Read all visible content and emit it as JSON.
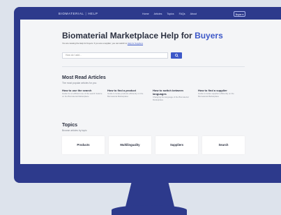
{
  "nav": {
    "brand_left": "BIOMATERIAL",
    "brand_right": "HELP",
    "links": [
      "Home",
      "Articles",
      "Topics",
      "FAQs",
      "About"
    ],
    "button_label": "Buyer ▾"
  },
  "hero": {
    "title_prefix": "Biomaterial Marketplace Help for ",
    "title_accent": "Buyers",
    "subtitle_text": "You are viewing the Help for buyers. If you are a supplier, you can switch to ",
    "subtitle_link": "Help for Suppliers",
    "search_placeholder": "How do I add...",
    "search_icon": "magnifier-icon"
  },
  "articles": {
    "title": "Most Read Articles",
    "subtitle": "The most popular articles for you",
    "items": [
      {
        "title": "How to use the search",
        "desc": "Guide for an efficient use of the search feature on the Biomaterial Marketplace"
      },
      {
        "title": "How to find a product",
        "desc": "Guide to locate products efficiently on the Biomaterial Marketplace"
      },
      {
        "title": "How to switch between languages",
        "desc": "Changing the language of the Biomaterial Marketplace"
      },
      {
        "title": "How to find a supplier",
        "desc": "Guide to locate suppliers efficiently on the Biomaterial Marketplace"
      }
    ]
  },
  "topics": {
    "title": "Topics",
    "subtitle": "Browse articles by topic",
    "items": [
      "Products",
      "Multilinguality",
      "Suppliers",
      "Search"
    ]
  },
  "colors": {
    "accent": "#3d58c8",
    "frame": "#2d3a8c",
    "background": "#dde3ec"
  }
}
